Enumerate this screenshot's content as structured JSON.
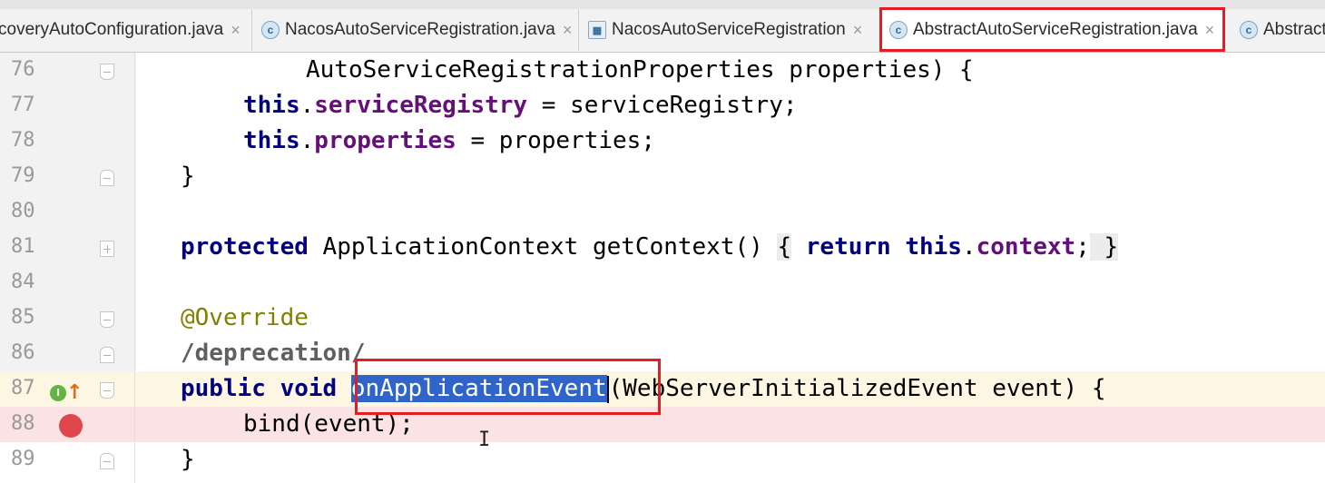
{
  "tabs": [
    {
      "label": "coveryAutoConfiguration.java",
      "icon": "class-icon",
      "closable": true,
      "active": false
    },
    {
      "label": "NacosAutoServiceRegistration.java",
      "icon": "class-icon",
      "closable": true,
      "active": false
    },
    {
      "label": "NacosAutoServiceRegistration",
      "icon": "structure-icon",
      "closable": true,
      "active": false
    },
    {
      "label": "AbstractAutoServiceRegistration.java",
      "icon": "abstract-class-icon",
      "closable": true,
      "active": true
    },
    {
      "label": "Abstract",
      "icon": "class-icon",
      "closable": false,
      "active": false
    }
  ],
  "close_glyph": "×",
  "gutter": {
    "line_numbers": [
      "76",
      "77",
      "78",
      "79",
      "80",
      "81",
      "84",
      "85",
      "86",
      "87",
      "88",
      "89"
    ]
  },
  "code": {
    "l76": {
      "t1": "AutoServiceRegistrationProperties properties) {"
    },
    "l77": {
      "kw": "this",
      "dot": ".",
      "field": "serviceRegistry",
      "rest": " = serviceRegistry;"
    },
    "l78": {
      "kw": "this",
      "dot": ".",
      "field": "properties",
      "rest": " = properties;"
    },
    "l79": {
      "t1": "}"
    },
    "l81": {
      "kw1": "protected",
      "t1": " ApplicationContext getContext() ",
      "b1": "{",
      "sp1": " ",
      "kw2": "return",
      "sp2": " ",
      "kw3": "this",
      "dot": ".",
      "field": "context",
      "semi": ";",
      "sp3": " ",
      "b2": "}"
    },
    "l85": {
      "ann": "@Override"
    },
    "l86": {
      "ann": "/deprecation/"
    },
    "l87": {
      "kw1": "public",
      "sp1": " ",
      "kw2": "void",
      "sp2": " ",
      "method": "onApplicationEvent",
      "rest": "(WebServerInitializedEvent event) {"
    },
    "l88": {
      "t1": "bind(event);"
    },
    "l89": {
      "t1": "}"
    }
  },
  "colors": {
    "keyword": "#000080",
    "field": "#660e7a",
    "annotation": "#808000",
    "selection": "#2f65ca",
    "highlight_box": "#e21d24",
    "breakpoint": "#e0474c"
  }
}
